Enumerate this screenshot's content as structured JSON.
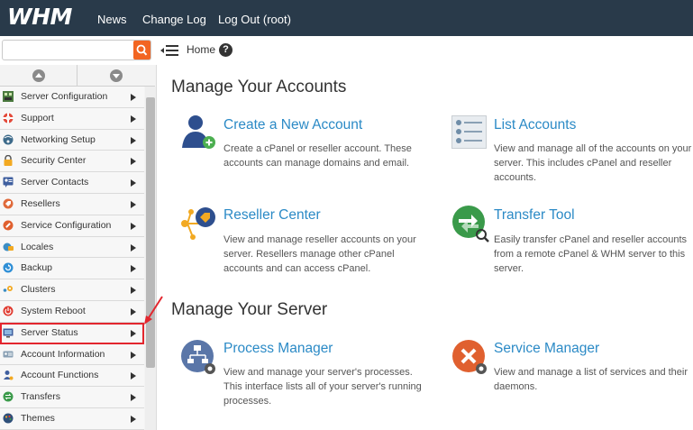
{
  "app": {
    "logo": "WHM"
  },
  "topnav": {
    "news": "News",
    "changelog": "Change Log",
    "logout": "Log Out (root)"
  },
  "search": {
    "placeholder": "",
    "value": ""
  },
  "breadcrumb": {
    "home": "Home",
    "help": "?"
  },
  "sidebar": {
    "items": [
      {
        "label": "Server Configuration",
        "icon": "server-configuration-icon"
      },
      {
        "label": "Support",
        "icon": "lifebuoy-icon"
      },
      {
        "label": "Networking Setup",
        "icon": "network-icon"
      },
      {
        "label": "Security Center",
        "icon": "lock-icon"
      },
      {
        "label": "Server Contacts",
        "icon": "contacts-icon"
      },
      {
        "label": "Resellers",
        "icon": "tag-icon"
      },
      {
        "label": "Service Configuration",
        "icon": "wrench-icon"
      },
      {
        "label": "Locales",
        "icon": "globe-chat-icon"
      },
      {
        "label": "Backup",
        "icon": "backup-icon"
      },
      {
        "label": "Clusters",
        "icon": "cluster-icon"
      },
      {
        "label": "System Reboot",
        "icon": "power-icon"
      },
      {
        "label": "Server Status",
        "icon": "monitor-icon",
        "selected": true
      },
      {
        "label": "Account Information",
        "icon": "id-card-icon"
      },
      {
        "label": "Account Functions",
        "icon": "user-icon"
      },
      {
        "label": "Transfers",
        "icon": "transfer-icon"
      },
      {
        "label": "Themes",
        "icon": "palette-icon"
      }
    ]
  },
  "main": {
    "sections": [
      {
        "title": "Manage Your Accounts",
        "cards": [
          {
            "title": "Create a New Account",
            "desc": [
              "Create a cPanel or reseller account. These",
              "accounts can manage domains and email."
            ],
            "icon": "add-user-icon"
          },
          {
            "title": "List Accounts",
            "desc": [
              "View and manage all of the accounts on your",
              "server. This includes cPanel and reseller",
              "accounts."
            ],
            "icon": "list-accounts-icon"
          },
          {
            "title": "Reseller Center",
            "desc": [
              "View and manage reseller accounts on your",
              "server. Resellers manage other cPanel",
              "accounts and can access cPanel."
            ],
            "icon": "reseller-center-icon"
          },
          {
            "title": "Transfer Tool",
            "desc": [
              "Easily transfer cPanel and reseller accounts",
              "from a remote cPanel & WHM server to this",
              "server."
            ],
            "icon": "transfer-tool-icon"
          }
        ]
      },
      {
        "title": "Manage Your Server",
        "cards": [
          {
            "title": "Process Manager",
            "desc": [
              "View and manage your server's processes.",
              "This interface lists all of your server's running",
              "processes."
            ],
            "icon": "process-manager-icon"
          },
          {
            "title": "Service Manager",
            "desc": [
              "View and manage a list of services and their",
              "daemons."
            ],
            "icon": "service-manager-icon"
          }
        ]
      }
    ]
  },
  "colors": {
    "topbar": "#293a4a",
    "accent": "#f26522",
    "link": "#2b8ac6",
    "highlight": "#e3262e"
  }
}
